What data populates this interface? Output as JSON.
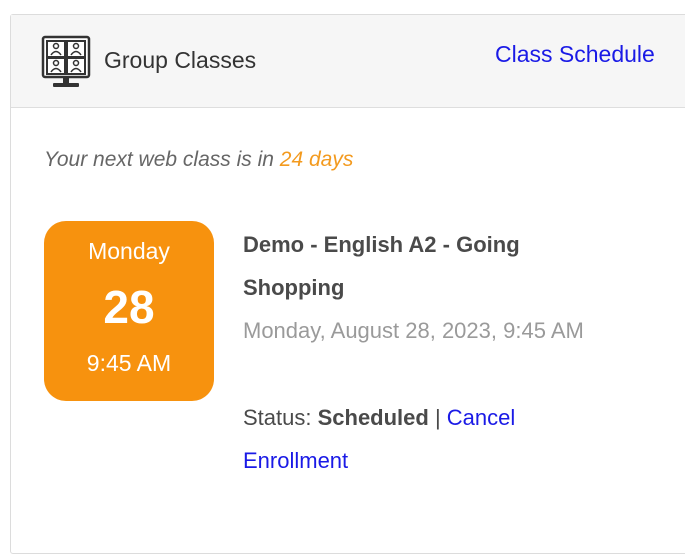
{
  "header": {
    "title": "Group Classes",
    "icon": "group-classes-icon",
    "schedule_link": "Class Schedule"
  },
  "next_class": {
    "prefix": "Your next web class is in ",
    "days": "24 days"
  },
  "badge": {
    "weekday": "Monday",
    "day": "28",
    "time": "9:45 AM"
  },
  "class": {
    "title": "Demo - English A2 - Going Shopping",
    "datetime": "Monday, August 28, 2023, 9:45 AM",
    "status_label": "Status: ",
    "status_value": "Scheduled",
    "separator": " | ",
    "cancel_link": "Cancel Enrollment"
  },
  "colors": {
    "accent": "#f7920e",
    "link": "#1a1ae6",
    "header_bg": "#f6f6f6"
  }
}
